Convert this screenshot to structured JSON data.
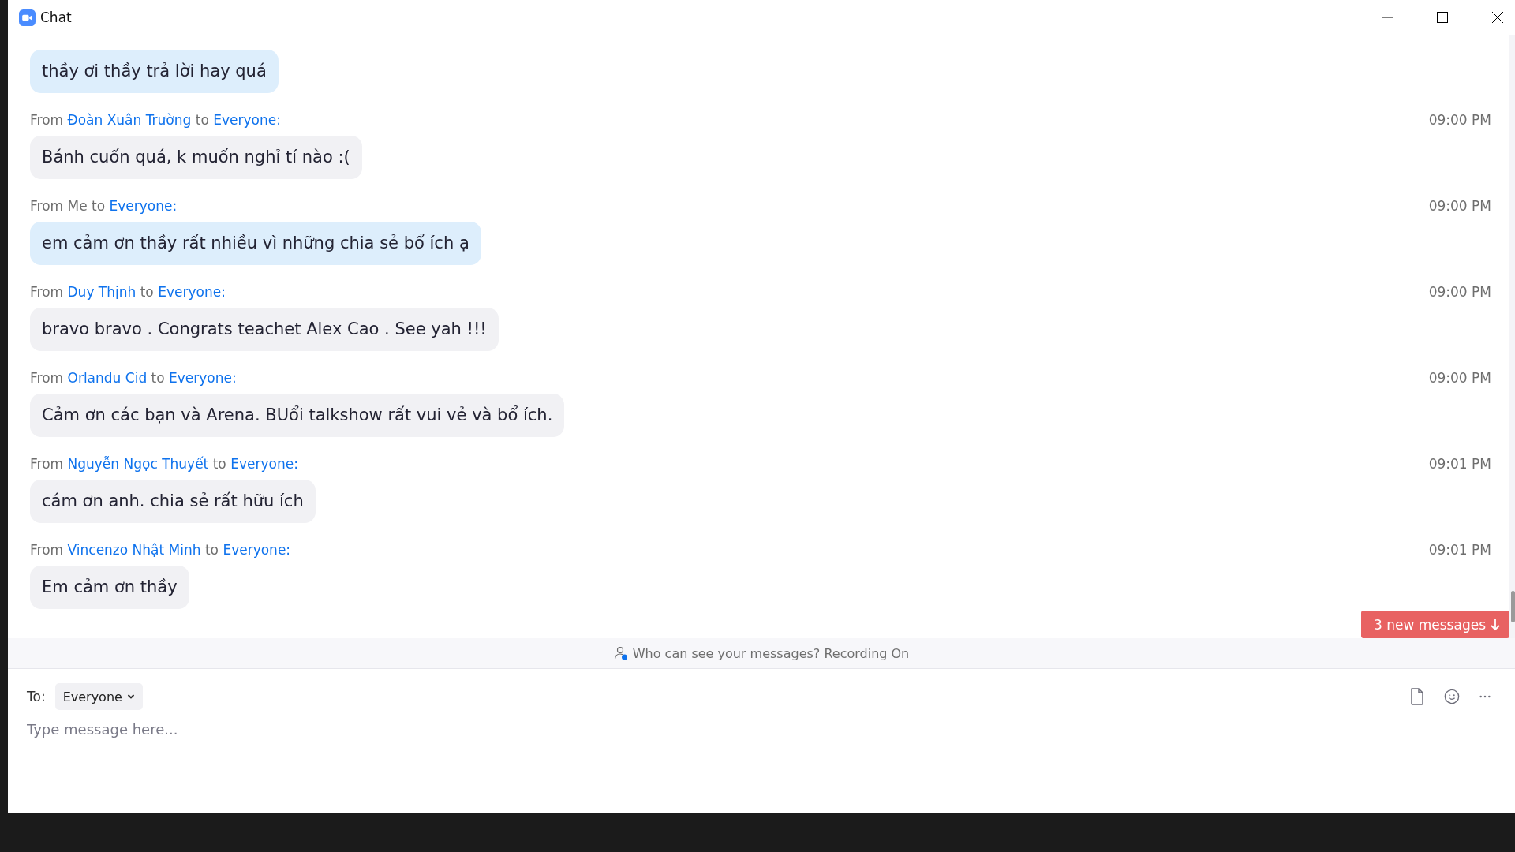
{
  "window": {
    "title": "Chat"
  },
  "messages": [
    {
      "kind": "sent",
      "text": "thầy ơi thầy trả lời hay quá"
    },
    {
      "kind": "received",
      "from_label": "From",
      "sender": "Đoàn Xuân Trường",
      "to_label": "to",
      "recipient": "Everyone:",
      "time": "09:00 PM",
      "text": "Bánh cuốn quá, k muốn nghỉ tí nào :("
    },
    {
      "kind": "sent",
      "from_label": "From",
      "sender": "Me",
      "to_label": "to",
      "recipient": "Everyone:",
      "time": "09:00 PM",
      "text": "em cảm ơn thầy rất nhiều vì những chia sẻ bổ ích ạ"
    },
    {
      "kind": "received",
      "from_label": "From",
      "sender": "Duy Thịnh",
      "to_label": "to",
      "recipient": "Everyone:",
      "time": "09:00 PM",
      "text": "bravo bravo . Congrats teachet Alex Cao . See yah !!!"
    },
    {
      "kind": "received",
      "from_label": "From",
      "sender": "Orlandu Cid",
      "to_label": "to",
      "recipient": "Everyone:",
      "time": "09:00 PM",
      "text": "Cảm ơn các bạn và Arena. BUổi talkshow rất vui vẻ và bổ ích."
    },
    {
      "kind": "received",
      "from_label": "From",
      "sender": "Nguyễn Ngọc Thuyết",
      "to_label": "to",
      "recipient": "Everyone:",
      "time": "09:01 PM",
      "text": "cám ơn anh. chia sẻ rất hữu ích"
    },
    {
      "kind": "received",
      "from_label": "From",
      "sender": "Vincenzo Nhật Minh",
      "to_label": "to",
      "recipient": "Everyone:",
      "time": "09:01 PM",
      "text": "Em cảm ơn thầy"
    }
  ],
  "new_messages_button": "3 new messages",
  "privacy_notice": "Who can see your messages? Recording On",
  "compose": {
    "to_label": "To:",
    "recipient": "Everyone",
    "placeholder": "Type message here..."
  }
}
